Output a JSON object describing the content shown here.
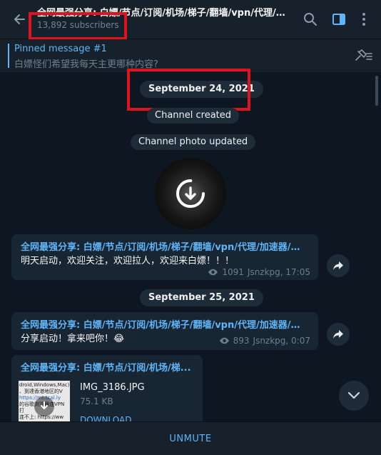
{
  "header": {
    "title": "全网最强分享: 白嫖/节点/订阅/机场/梯子/翻墙/vpn/代理/加...",
    "subscribers": "13,892 subscribers"
  },
  "pinned": {
    "title": "Pinned message #1",
    "text": "白嫖怪们希望我每天主更哪种内容?"
  },
  "feed": {
    "date1": "September 24, 2021",
    "service1": "Channel created",
    "service2": "Channel photo updated",
    "date2": "September 25, 2021",
    "messages": [
      {
        "author": "全网最强分享: 白嫖/节点/订阅/机场/梯子/翻墙/vpn/代理/加速器/科...",
        "text": "明天启动，欢迎关注，欢迎拉人，欢迎来白嫖！！！",
        "views": "1091",
        "signature": "Jsnzkpg, 17:05"
      },
      {
        "author": "全网最强分享: 白嫖/节点/订阅/机场/梯子/翻墙/vpn/代理/加速器/科...",
        "text": "分享启动！拿来吧你！😂",
        "views": "893",
        "signature": "Jsnzkpg, 0:07"
      }
    ],
    "file_message": {
      "author": "全网最强分享: 白嫖/节点/订阅/机场/梯...",
      "file_name": "IMG_3186.JPG",
      "file_size": "75.1 KB",
      "download": "DOWNLOAD",
      "thumb_lines": [
        "droid,Windows,Mac)",
        "、到達香港地区的V",
        "https://mt.tcal.ly",
        "的谷歌浏览器连VPN打",
        "连不上: https://ww"
      ]
    }
  },
  "footer": {
    "unmute": "UNMUTE"
  },
  "colors": {
    "accent": "#5eb5f7",
    "bg": "#0e1621",
    "panel": "#17212b",
    "bubble": "#182533",
    "highlight": "#e0121b"
  }
}
